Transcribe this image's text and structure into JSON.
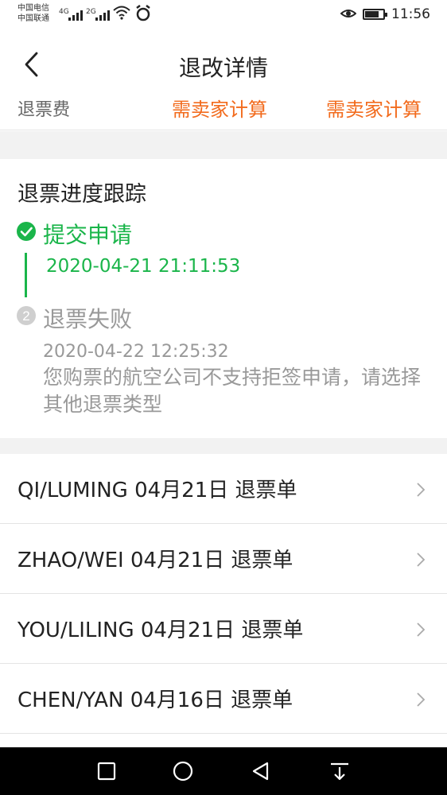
{
  "status_bar": {
    "carrier1": "中国电信",
    "carrier2": "中国联通",
    "net1": "4G",
    "net2": "2G",
    "time": "11:56",
    "icons": [
      "signal-icon",
      "wifi-icon",
      "alarm-icon",
      "eye-icon",
      "battery-icon"
    ]
  },
  "nav": {
    "title": "退改详情",
    "back_icon": "chevron-left-icon"
  },
  "fee": {
    "label": "退票费",
    "value1": "需卖家计算",
    "value2": "需卖家计算",
    "accent": "#f26b1d"
  },
  "progress": {
    "title": "退票进度跟踪",
    "accent": "#1ab54a",
    "steps": [
      {
        "label": "提交申请",
        "time": "2020-04-21 21:11:53",
        "status": "done"
      },
      {
        "number": "2",
        "label": "退票失败",
        "time": "2020-04-22 12:25:32",
        "desc": "您购票的航空公司不支持拒签申请，请选择其他退票类型",
        "status": "failed"
      }
    ]
  },
  "refund_list": [
    {
      "text": "QI/LUMING 04月21日 退票单"
    },
    {
      "text": "ZHAO/WEI 04月21日 退票单"
    },
    {
      "text": "YOU/LILING 04月21日 退票单"
    },
    {
      "text": "CHEN/YAN 04月16日 退票单"
    }
  ],
  "system_nav": [
    "square-icon",
    "circle-icon",
    "triangle-back-icon",
    "notification-down-icon"
  ]
}
